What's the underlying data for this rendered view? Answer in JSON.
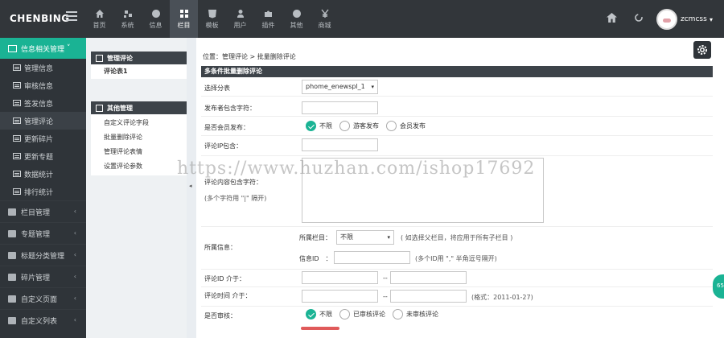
{
  "app": {
    "logo": "CHENBING",
    "username": "zcmcss",
    "user_caret": "▾"
  },
  "topnav": [
    {
      "label": "首页",
      "icon": "home-icon"
    },
    {
      "label": "系统",
      "icon": "cogs-icon"
    },
    {
      "label": "信息",
      "icon": "globe-icon"
    },
    {
      "label": "栏目",
      "icon": "grid-icon"
    },
    {
      "label": "模板",
      "icon": "html5-icon"
    },
    {
      "label": "用户",
      "icon": "user-icon"
    },
    {
      "label": "插件",
      "icon": "puzzle-icon"
    },
    {
      "label": "其他",
      "icon": "user-circle-icon"
    },
    {
      "label": "商城",
      "icon": "yen-icon"
    }
  ],
  "topnav_active": "栏目",
  "sidebar": {
    "active_group": "信息相关管理",
    "active_group_caret": "˅",
    "sub_items": [
      "管理信息",
      "审核信息",
      "签发信息",
      "管理评论",
      "更新碎片",
      "更新专题",
      "数据统计",
      "排行统计"
    ],
    "highlighted_sub": "管理评论",
    "groups": [
      {
        "label": "栏目管理",
        "arrow": "‹"
      },
      {
        "label": "专题管理",
        "arrow": "‹"
      },
      {
        "label": "标题分类管理",
        "arrow": "‹"
      },
      {
        "label": "碎片管理",
        "arrow": "‹"
      },
      {
        "label": "自定义页面",
        "arrow": "‹"
      },
      {
        "label": "自定义列表",
        "arrow": "‹"
      }
    ]
  },
  "subpanel": {
    "section1_title": "管理评论",
    "section1_links": [
      "评论表1"
    ],
    "section2_title": "其他管理",
    "section2_links": [
      "自定义评论字段",
      "批量删除评论",
      "管理评论表情",
      "设置评论参数"
    ]
  },
  "splitter_arrow": "◂",
  "breadcrumb": {
    "prefix": "位置：",
    "link": "管理评论",
    "sep": " > ",
    "current": "批量删除评论"
  },
  "form": {
    "title": "多条件批量删除评论",
    "table_label": "选择分表",
    "table_value": "phome_enewspl_1",
    "select_caret": "▾",
    "publisher_label": "发布者包含字符：",
    "publisher_value": "",
    "is_member_label": "是否会员发布：",
    "is_member_options": [
      "不限",
      "游客发布",
      "会员发布"
    ],
    "is_member_selected": "不限",
    "ip_label": "评论IP包含：",
    "ip_value": "",
    "content_label": "评论内容包含字符：",
    "content_hint": "(多个字符用 \"|\" 隔开)",
    "content_value": "",
    "info_label": "所属信息：",
    "column_label": "所属栏目：",
    "column_value": "不限",
    "column_hint": "( 如选择父栏目，将应用于所有子栏目 )",
    "infoid_label": "信息ID　：",
    "infoid_value": "",
    "infoid_hint": "(多个ID用 \",\" 半角逗号隔开)",
    "commentid_label": "评论ID 介于：",
    "commentid_from": "",
    "commentid_to": "",
    "range_sep": "--",
    "time_label": "评论时间 介于：",
    "time_from": "",
    "time_to": "",
    "time_hint": "(格式：2011-01-27)",
    "audit_label": "是否审核：",
    "audit_options": [
      "不限",
      "已审核评论",
      "未审核评论"
    ],
    "audit_selected": "不限"
  },
  "watermark": "https://www.huzhan.com/ishop17692",
  "float_badge": "65"
}
